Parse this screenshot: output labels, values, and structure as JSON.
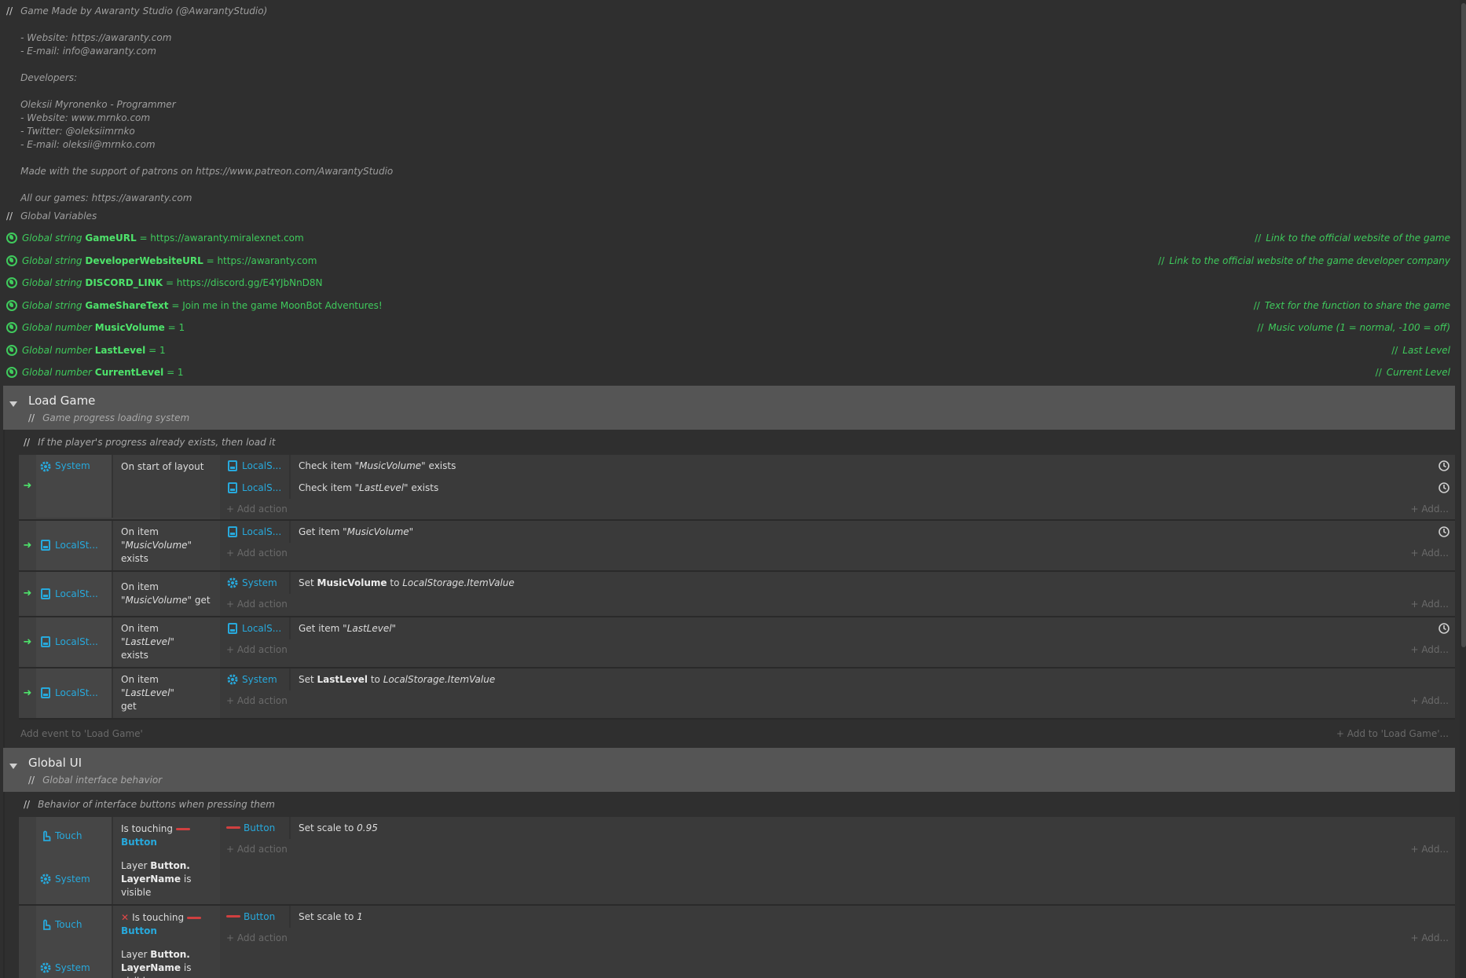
{
  "header_comment": {
    "lines": [
      "Game Made by Awaranty Studio (@AwarantyStudio)",
      "",
      "- Website: https://awaranty.com",
      "- E-mail: info@awaranty.com",
      "",
      "Developers:",
      "",
      "Oleksii Myronenko - Programmer",
      "- Website: www.mrnko.com",
      "- Twitter: @oleksiimrnko",
      "- E-mail: oleksii@mrnko.com",
      "",
      "Made with the support of patrons on https://www.patreon.com/AwarantyStudio",
      "",
      "All our games: https://awaranty.com"
    ]
  },
  "globals_comment": "Global Variables",
  "globals": [
    {
      "kw": "Global string",
      "name": "GameURL",
      "value": "= https://awaranty.miralexnet.com",
      "comment": "Link to the official website of the game"
    },
    {
      "kw": "Global string",
      "name": "DeveloperWebsiteURL",
      "value": "= https://awaranty.com",
      "comment": "Link to the official website of the game developer company"
    },
    {
      "kw": "Global string",
      "name": "DISCORD_LINK",
      "value": "= https://discord.gg/E4YJbNnD8N",
      "comment": ""
    },
    {
      "kw": "Global string",
      "name": "GameShareText",
      "value": "= Join me in the game MoonBot Adventures!",
      "comment": "Text for the function to share the game"
    },
    {
      "kw": "Global number",
      "name": "MusicVolume",
      "value": "= 1",
      "comment": "Music volume (1 = normal, -100 = off)"
    },
    {
      "kw": "Global number",
      "name": "LastLevel",
      "value": "= 1",
      "comment": "Last Level"
    },
    {
      "kw": "Global number",
      "name": "CurrentLevel",
      "value": "= 1",
      "comment": "Current Level"
    }
  ],
  "load_game": {
    "title": "Load Game",
    "desc": "Game progress loading system",
    "inner_comment": "If the player's progress already exists, then load it",
    "add_event": "Add event to 'Load Game'",
    "add_to": "Add to 'Load Game'..."
  },
  "global_ui": {
    "title": "Global UI",
    "desc": "Global interface behavior",
    "inner_comment": "Behavior of interface buttons when pressing them"
  },
  "labels": {
    "system": "System",
    "localst": "LocalSt...",
    "locals": "LocalS...",
    "touch": "Touch",
    "button": "Button",
    "add_action": "Add action",
    "add": "Add...",
    "slashes": "//"
  },
  "ev1": {
    "cond": "On start of layout",
    "a1_pre": "Check item ",
    "a1_it": "\"MusicVolume\"",
    "a1_post": " exists",
    "a2_pre": "Check item ",
    "a2_it": "\"LastLevel\"",
    "a2_post": " exists"
  },
  "ev2": {
    "c_pre": "On item",
    "c_it": "\"MusicVolume\"",
    "c_post": " exists",
    "a_pre": "Get item ",
    "a_it": "\"MusicVolume\""
  },
  "ev3": {
    "c_pre": "On item",
    "c_it": "\"MusicVolume\"",
    "c_post": " get",
    "a_pre": "Set ",
    "a_b": "MusicVolume",
    "a_mid": " to ",
    "a_it": "LocalStorage.ItemValue"
  },
  "ev4": {
    "c_pre": "On item ",
    "c_it": "\"LastLevel\"",
    "c_post": "exists",
    "a_pre": "Get item ",
    "a_it": "\"LastLevel\""
  },
  "ev5": {
    "c_pre": "On item ",
    "c_it": "\"LastLevel\"",
    "c_post": "get",
    "a_pre": "Set ",
    "a_b": "LastLevel",
    "a_mid": " to ",
    "a_it": "LocalStorage.ItemValue"
  },
  "ui1": {
    "c1_pre": "Is touching",
    "c1_obj": "Button",
    "c2_pre": "Layer ",
    "c2_b1": "Button.",
    "c2_b2": "LayerName",
    "c2_post": " is visible",
    "a_pre": "Set scale to ",
    "a_it": "0.95"
  },
  "ui2": {
    "c1_pre": "Is touching",
    "c1_obj": "Button",
    "c2_pre": "Layer ",
    "c2_b1": "Button.",
    "c2_b2": "LayerName",
    "c2_post": " is visible",
    "a_pre": "Set scale to ",
    "a_it": "1"
  }
}
